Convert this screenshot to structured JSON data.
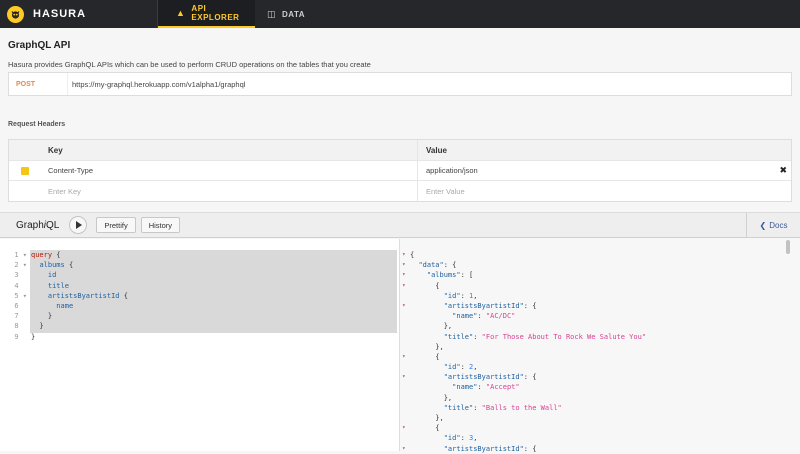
{
  "app": {
    "brand": "HASURA"
  },
  "nav": {
    "api_explorer": "API EXPLORER",
    "data": "DATA"
  },
  "page": {
    "title": "GraphQL API",
    "subtitle": "Hasura provides GraphQL APIs which can be used to perform CRUD operations on the tables that you create"
  },
  "endpoint": {
    "method": "POST",
    "url": "https://my-graphql.herokuapp.com/v1alpha1/graphql"
  },
  "headers": {
    "label": "Request Headers",
    "col_key": "Key",
    "col_value": "Value",
    "rows": [
      {
        "key": "Content-Type",
        "value": "application/json"
      }
    ],
    "key_placeholder": "Enter Key",
    "value_placeholder": "Enter Value"
  },
  "graphiql": {
    "title_prefix": "Graph",
    "title_i": "i",
    "title_suffix": "QL",
    "prettify": "Prettify",
    "history": "History",
    "docs": "Docs"
  },
  "query_lines": [
    "query {",
    "  albums {",
    "    id",
    "    title",
    "    artistsByartistId {",
    "      name",
    "    }",
    "  }",
    "}"
  ],
  "result_lines": [
    "{",
    "  \"data\": {",
    "    \"albums\": [",
    "      {",
    "        \"id\": 1,",
    "        \"artistsByartistId\": {",
    "          \"name\": \"AC/DC\"",
    "        },",
    "        \"title\": \"For Those About To Rock We Salute You\"",
    "      },",
    "      {",
    "        \"id\": 2,",
    "        \"artistsByartistId\": {",
    "          \"name\": \"Accept\"",
    "        },",
    "        \"title\": \"Balls to the Wall\"",
    "      },",
    "      {",
    "        \"id\": 3,",
    "        \"artistsByartistId\": {"
  ],
  "colors": {
    "accent": "#ffca28",
    "topbar": "#26272b",
    "method": "#e8894a"
  }
}
